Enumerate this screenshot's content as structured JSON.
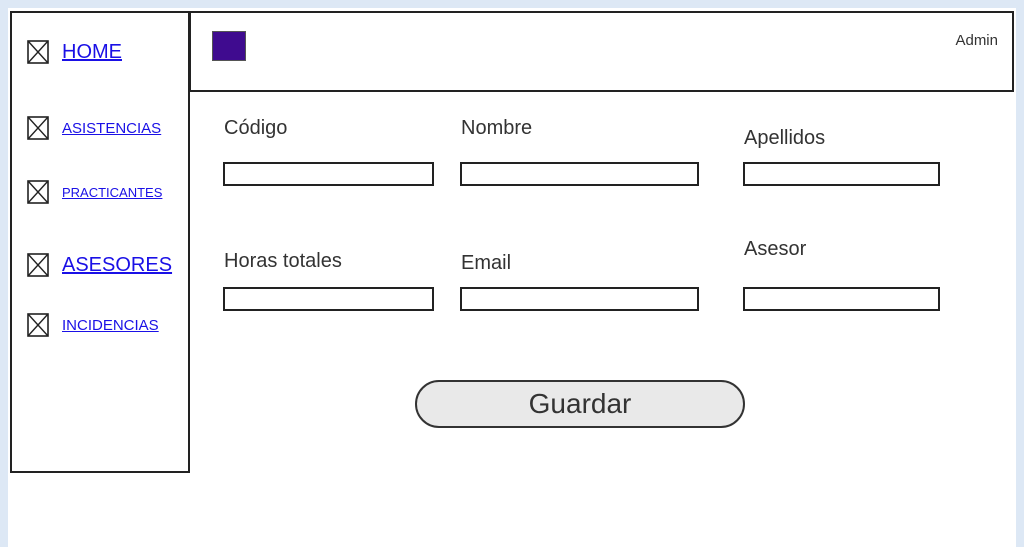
{
  "sidebar": {
    "items": [
      {
        "label": "HOME",
        "icon": "broken-image-icon"
      },
      {
        "label": "ASISTENCIAS",
        "icon": "broken-image-icon"
      },
      {
        "label": "PRACTICANTES",
        "icon": "broken-image-icon"
      },
      {
        "label": "ASESORES",
        "icon": "broken-image-icon"
      },
      {
        "label": "INCIDENCIAS",
        "icon": "broken-image-icon"
      }
    ]
  },
  "header": {
    "user_label": "Admin",
    "logo_color": "#3f0b8f"
  },
  "form": {
    "codigo_label": "Código",
    "nombre_label": "Nombre",
    "apellidos_label": "Apellidos",
    "horas_label": "Horas totales",
    "email_label": "Email",
    "asesor_label": "Asesor",
    "codigo_value": "",
    "nombre_value": "",
    "apellidos_value": "",
    "horas_value": "",
    "email_value": "",
    "asesor_value": "",
    "save_label": "Guardar"
  },
  "colors": {
    "link": "#1a10e6",
    "background": "#dde8f5",
    "button": "#e9e9e9"
  }
}
